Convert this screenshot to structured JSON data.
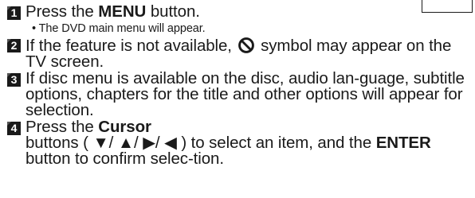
{
  "steps": [
    {
      "number": "1",
      "pre": "Press the ",
      "bold": "MENU",
      "post": " button.",
      "note": "• The DVD main menu will appear."
    },
    {
      "number": "2",
      "pre": "If the feature is not available, ",
      "icon": "prohibit-icon",
      "post": " symbol may appear on the TV screen."
    },
    {
      "number": "3",
      "text": "If disc menu is available on the disc, audio lan-guage, subtitle options, chapters for the title and other options will appear for selection."
    },
    {
      "number": "4",
      "pre": "Press the ",
      "bold": "Cursor",
      "mid": " buttons ( ▼/ ▲/ ▶/ ◀ ) to select an item, and the ",
      "bold2": "ENTER",
      "post": " button to confirm selec-tion."
    }
  ]
}
